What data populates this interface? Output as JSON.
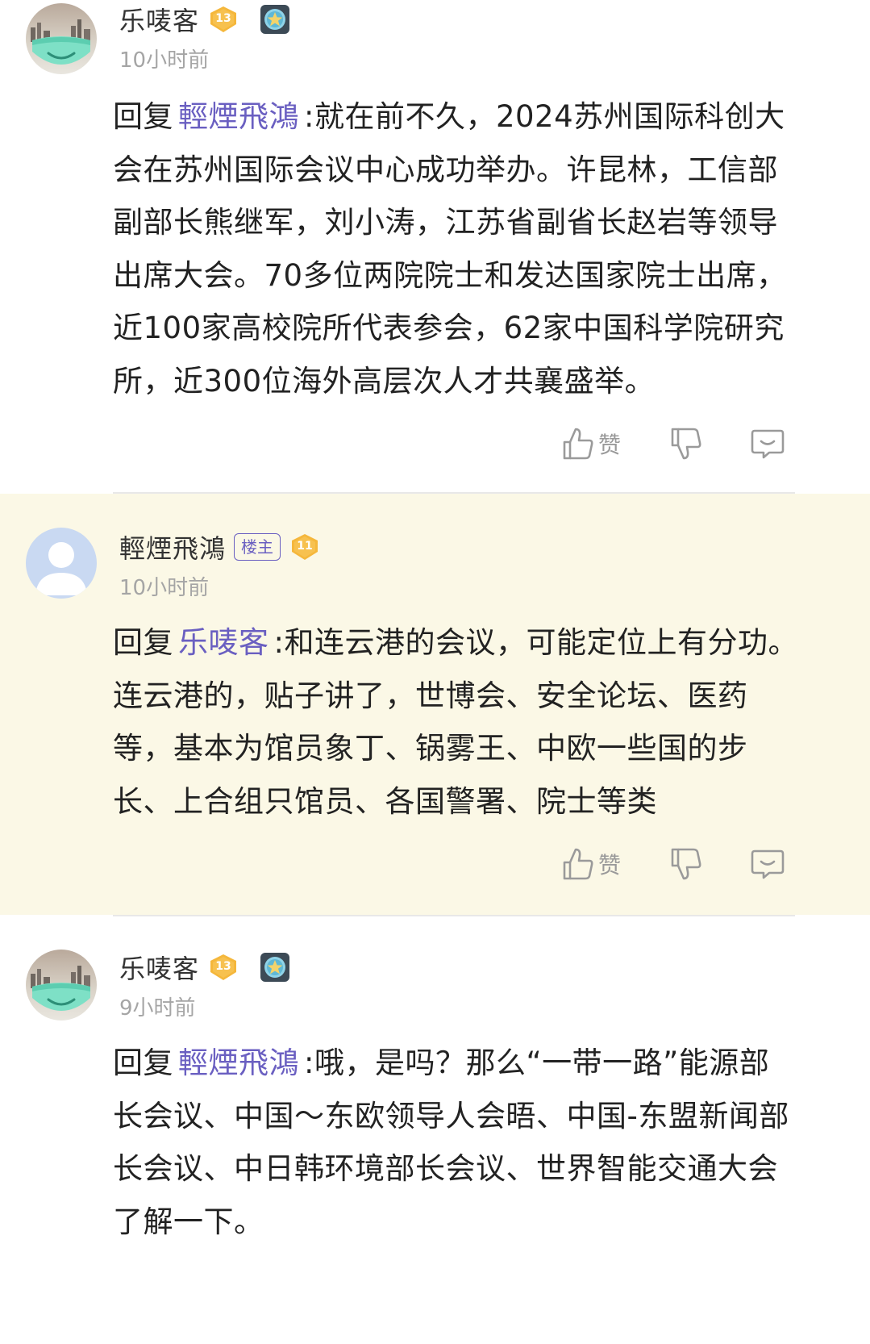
{
  "comments": [
    {
      "username": "乐唛客",
      "level": "13",
      "time": "10小时前",
      "reply_prefix": "回复",
      "reply_target": "輕煙飛鴻",
      "content": ":就在前不久，2024苏州国际科创大会在苏州国际会议中心成功举办。许昆林，工信部副部长熊继军，刘小涛，江苏省副省长赵岩等领导出席大会。70多位两院院士和发达国家院士出席，近100家高校院所代表参会，62家中国科学院研究所，近300位海外高层次人才共襄盛举。",
      "like_label": "赞"
    },
    {
      "username": "輕煙飛鴻",
      "owner_tag": "楼主",
      "level": "11",
      "time": "10小时前",
      "reply_prefix": "回复",
      "reply_target": "乐唛客",
      "content": ":和连云港的会议，可能定位上有分功。连云港的，贴子讲了，世博会、安全论坛、医药等，基本为馆员象丁、锅雾王、中欧一些国的步长、上合组只馆员、各国警署、院士等类",
      "like_label": "赞"
    },
    {
      "username": "乐唛客",
      "level": "13",
      "time": "9小时前",
      "reply_prefix": "回复",
      "reply_target": "輕煙飛鴻",
      "content": ":哦，是吗？那么“一带一路”能源部长会议、中国～东欧领导人会晤、中国-东盟新闻部长会议、中日韩环境部长会议、世界智能交通大会了解一下。"
    }
  ],
  "colors": {
    "link": "#6a5fc1",
    "highlight_bg": "#fbf8e6",
    "level_badge": "#f5b73b",
    "time": "#a5a5a5"
  },
  "icons": [
    "thumbs-up-icon",
    "thumbs-down-icon",
    "reply-bubble-icon",
    "medal-icon",
    "level-badge-icon"
  ]
}
